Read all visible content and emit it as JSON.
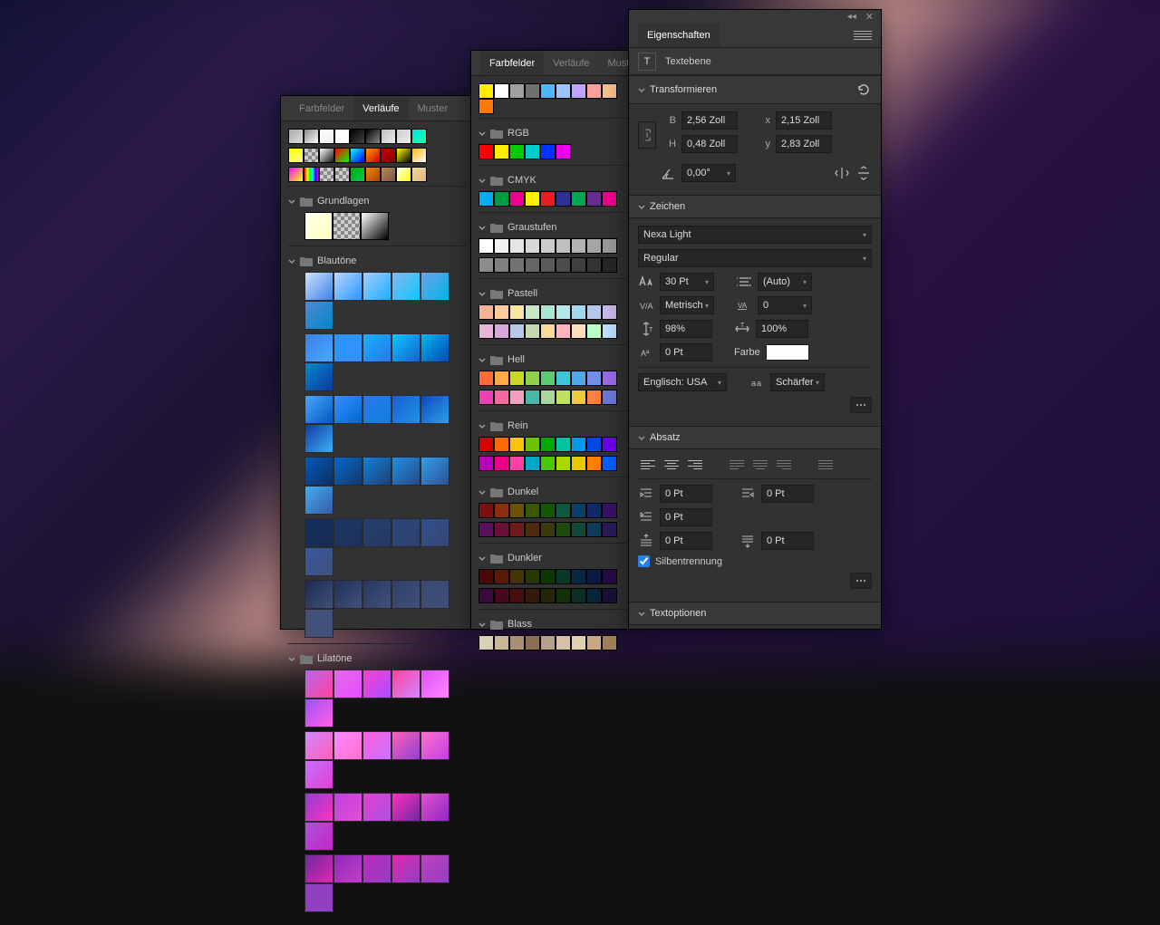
{
  "panel_gradients": {
    "tabs": [
      "Farbfelder",
      "Verläufe",
      "Muster"
    ],
    "active_tab_index": 1,
    "top_presets": [
      [
        "#aaa",
        "#ddd"
      ],
      [
        "#888",
        "#fff"
      ],
      [
        "#fff",
        "#eee"
      ],
      [
        "#fff",
        "#fff"
      ],
      [
        "#000",
        "#444"
      ],
      [
        "#000",
        "#888"
      ],
      [
        "#bbb",
        "#eee"
      ],
      [
        "#ccc",
        "#eee"
      ],
      [
        "#0dd",
        "#2fa"
      ]
    ],
    "preset_row2": [
      [
        "#ff0",
        "#ff8"
      ],
      [
        "checker"
      ],
      [
        "#fff",
        "#111"
      ],
      [
        "#f00",
        "#0f0"
      ],
      [
        "#0ff",
        "#00f"
      ],
      [
        "#f90",
        "#c00"
      ],
      [
        "#c00",
        "#800"
      ],
      [
        "#ff0",
        "#000"
      ],
      [
        "#fb0",
        "#fff"
      ]
    ],
    "preset_row3": [
      [
        "#f0f",
        "#ff0"
      ],
      [
        "#f00",
        "#ff0",
        "#0f0",
        "#0ff",
        "#00f",
        "#f0f"
      ],
      [
        "checker"
      ],
      [
        "checker"
      ],
      [
        "#0a0",
        "#0c5"
      ],
      [
        "#e80",
        "#a40"
      ],
      [
        "#b85",
        "#754"
      ],
      [
        "#fff",
        "#ff0"
      ],
      [
        "#f3d6a0",
        "#e0b878"
      ]
    ],
    "groups": [
      {
        "name": "Grundlagen",
        "type": "basic",
        "swatches": [
          [
            "#ffe",
            "#ffb"
          ],
          [
            "checker"
          ],
          [
            "#fff",
            "#000"
          ]
        ]
      },
      {
        "name": "Blautöne",
        "type": "blue"
      },
      {
        "name": "Lilatöne",
        "type": "purple"
      }
    ]
  },
  "panel_swatches": {
    "tabs": [
      "Farbfelder",
      "Verläufe",
      "Muster"
    ],
    "active_tab_index": 0,
    "top_row": [
      "#ffec00",
      "#ffffff",
      "#a0a0a0",
      "#707070",
      "#4cb6ff",
      "#9bc4ff",
      "#c1a3ff",
      "#ffa0a0",
      "#f7c08a",
      "#ff7a00"
    ],
    "groups": [
      {
        "name": "RGB",
        "rows": [
          [
            "#ff0000",
            "#ffee00",
            "#00cc00",
            "#00cccc",
            "#0033ff",
            "#ee00ee"
          ]
        ]
      },
      {
        "name": "CMYK",
        "rows": [
          [
            "#00aeef",
            "#009944",
            "#ec008c",
            "#fff200",
            "#ed1c24",
            "#2e3192",
            "#00a651",
            "#662d91",
            "#ec008c"
          ]
        ]
      },
      {
        "name": "Graustufen",
        "rows": [
          [
            "#ffffff",
            "#f2f2f2",
            "#e5e5e5",
            "#d8d8d8",
            "#cccccc",
            "#bfbfbf",
            "#b2b2b2",
            "#a5a5a5",
            "#999999"
          ],
          [
            "#8c8c8c",
            "#7f7f7f",
            "#727272",
            "#666666",
            "#595959",
            "#4c4c4c",
            "#3f3f3f",
            "#333333",
            "#262626"
          ]
        ]
      },
      {
        "name": "Pastell",
        "rows": [
          [
            "#f7b195",
            "#ffcc99",
            "#f9e79f",
            "#c8e6c9",
            "#a8e6cf",
            "#b4e7e8",
            "#a0d8ef",
            "#b5c7eb",
            "#c7b8ea"
          ],
          [
            "#e8b5d8",
            "#d8a8d8",
            "#b8c8e8",
            "#c7d8b0",
            "#f7da9c",
            "#ffb3ba",
            "#ffdfba",
            "#baffc9",
            "#bae1ff"
          ]
        ]
      },
      {
        "name": "Hell",
        "rows": [
          [
            "#ff6b35",
            "#ffa947",
            "#c8d825",
            "#8fd14f",
            "#5cc971",
            "#3cc4d8",
            "#4fa8e8",
            "#748de8",
            "#9a6be8"
          ],
          [
            "#ee40b5",
            "#ee6aa0",
            "#f2a0c2",
            "#4ab8a8",
            "#a8d89e",
            "#c0e060",
            "#f0c83c",
            "#ff8040",
            "#6a78d8"
          ]
        ]
      },
      {
        "name": "Rein",
        "rows": [
          [
            "#d90000",
            "#ff6a00",
            "#ffc400",
            "#6cc400",
            "#00a800",
            "#00c4a0",
            "#0098e8",
            "#0048e8",
            "#6a00e8"
          ],
          [
            "#b800b8",
            "#e80088",
            "#ff40a8",
            "#00a8c8",
            "#48c800",
            "#a8d800",
            "#e8c800",
            "#ff8000",
            "#0060ff"
          ]
        ]
      },
      {
        "name": "Dunkel",
        "rows": [
          [
            "#7a1010",
            "#8a2e0e",
            "#6a5200",
            "#3a5800",
            "#115800",
            "#0e5840",
            "#0a4068",
            "#102a68",
            "#3a1068"
          ],
          [
            "#5a105a",
            "#6a0e3a",
            "#701a1a",
            "#502a0e",
            "#3a3a0e",
            "#204a10",
            "#104a3a",
            "#103a5a",
            "#2a1a5a"
          ]
        ]
      },
      {
        "name": "Dunkler",
        "rows": [
          [
            "#4a0808",
            "#5a1a08",
            "#453400",
            "#253800",
            "#0a3800",
            "#083828",
            "#062845",
            "#0a1a45",
            "#250a45"
          ],
          [
            "#3a0a3a",
            "#45081f",
            "#480e0e",
            "#341a08",
            "#252508",
            "#143008",
            "#0a3025",
            "#0a253a",
            "#1a103a"
          ]
        ]
      },
      {
        "name": "Blass",
        "rows": [
          [
            "#dad0b8",
            "#c8b898",
            "#a89070",
            "#8a7050",
            "#b8a088",
            "#d8c0a8",
            "#e0d0b0",
            "#c8a880",
            "#a08058"
          ]
        ]
      }
    ]
  },
  "panel_properties": {
    "title": "Eigenschaften",
    "layer_type": "Textebene",
    "sections": {
      "transform": {
        "title": "Transformieren",
        "B_label": "B",
        "B": "2,56 Zoll",
        "x_label": "x",
        "x": "2,15 Zoll",
        "H_label": "H",
        "H": "0,48 Zoll",
        "y_label": "y",
        "y": "2,83 Zoll",
        "angle": "0,00°"
      },
      "character": {
        "title": "Zeichen",
        "font": "Nexa Light",
        "style": "Regular",
        "size": "30 Pt",
        "leading": "(Auto)",
        "tracking_mode": "Metrisch",
        "tracking": "0",
        "vscale": "98%",
        "hscale": "100%",
        "baseline": "0 Pt",
        "color_label": "Farbe",
        "color": "#ffffff",
        "language": "Englisch: USA",
        "aa_label": "Schärfer"
      },
      "paragraph": {
        "title": "Absatz",
        "indent_left": "0 Pt",
        "indent_right": "0 Pt",
        "indent_first": "0 Pt",
        "space_before": "0 Pt",
        "space_after": "0 Pt",
        "hyphenation_label": "Silbentrennung",
        "hyphenation": true
      },
      "textoptions": {
        "title": "Textoptionen"
      }
    }
  }
}
